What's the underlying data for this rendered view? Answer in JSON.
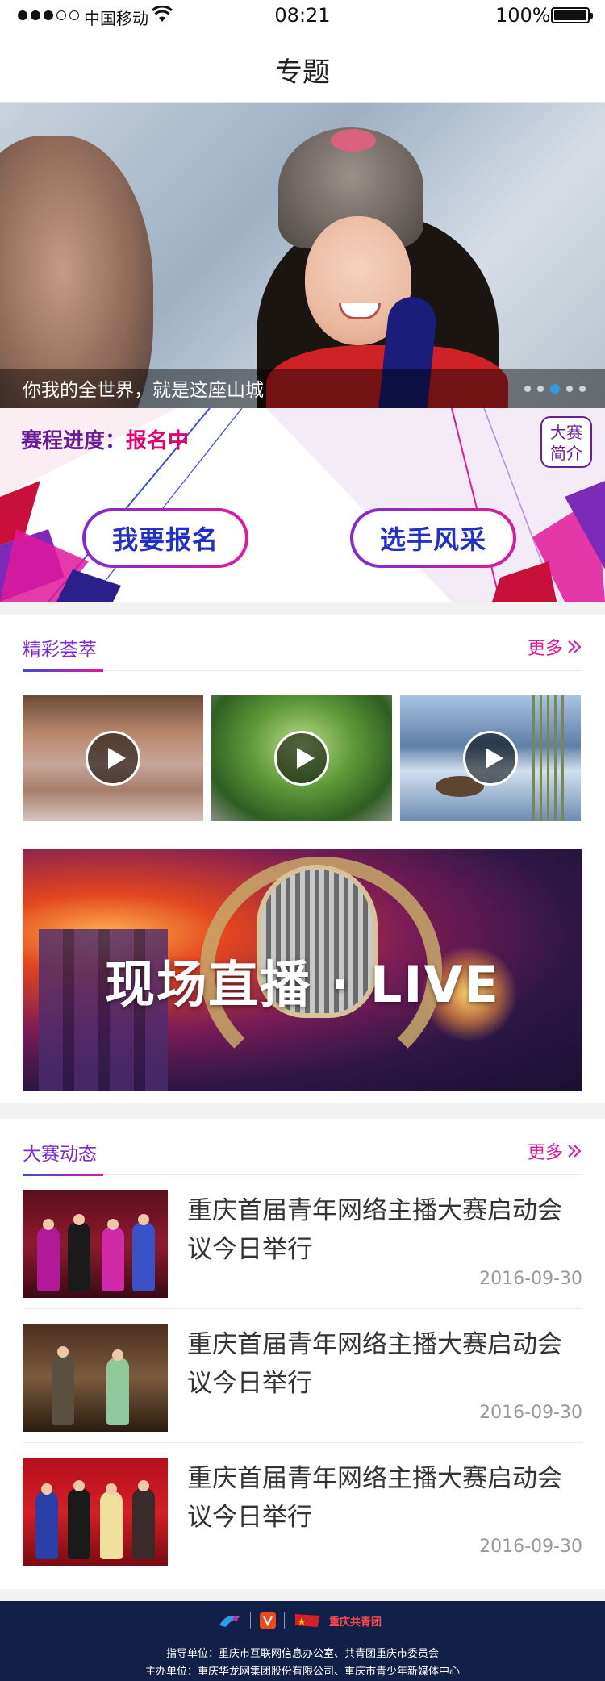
{
  "status_bar": {
    "carrier": "中国移动",
    "time": "08:21",
    "battery": "100%"
  },
  "nav": {
    "title": "专题"
  },
  "hero": {
    "caption": "你我的全世界，就是这座山城",
    "pages": 5,
    "active_page": 3
  },
  "contest": {
    "progress_label": "赛程进度：",
    "progress_status": "报名中",
    "intro_line1": "大赛",
    "intro_line2": "简介",
    "signup_label": "我要报名",
    "contestants_label": "选手风采"
  },
  "highlights": {
    "title": "精彩荟萃",
    "more_label": "更多",
    "live_banner": "现场直播 · LIVE"
  },
  "news": {
    "title": "大赛动态",
    "more_label": "更多",
    "items": [
      {
        "title": "重庆首届青年网络主播大赛启动会议今日举行",
        "date": "2016-09-30"
      },
      {
        "title": "重庆首届青年网络主播大赛启动会议今日举行",
        "date": "2016-09-30"
      },
      {
        "title": "重庆首届青年网络主播大赛启动会议今日举行",
        "date": "2016-09-30"
      }
    ]
  },
  "footer": {
    "logo_text": "重庆共青团",
    "guide": "指导单位：重庆市互联网信息办公室、共青团重庆市委员会",
    "host": "主办单位：重庆华龙网集团股份有限公司、重庆市青少年新媒体中心"
  },
  "colors": {
    "accent_purple": "#7a2bd8",
    "accent_pink": "#e0189a",
    "button_text": "#2230c8",
    "footer_bg": "#112048",
    "pager_active": "#2e9bea"
  }
}
